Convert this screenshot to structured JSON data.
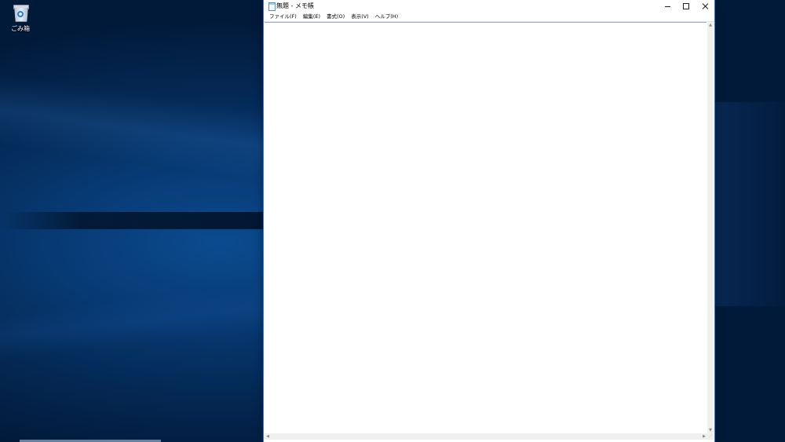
{
  "desktop": {
    "icons": [
      {
        "label": "ごみ箱",
        "icon": "recycle-bin-icon"
      }
    ]
  },
  "notepad": {
    "title": "無題 - メモ帳",
    "menu": [
      {
        "label": "ファイル(F)"
      },
      {
        "label": "編集(E)"
      },
      {
        "label": "書式(O)"
      },
      {
        "label": "表示(V)"
      },
      {
        "label": "ヘルプ(H)"
      }
    ],
    "content": "",
    "colors": {
      "window_border": "#2b7cd6",
      "desktop": "#063468"
    }
  }
}
